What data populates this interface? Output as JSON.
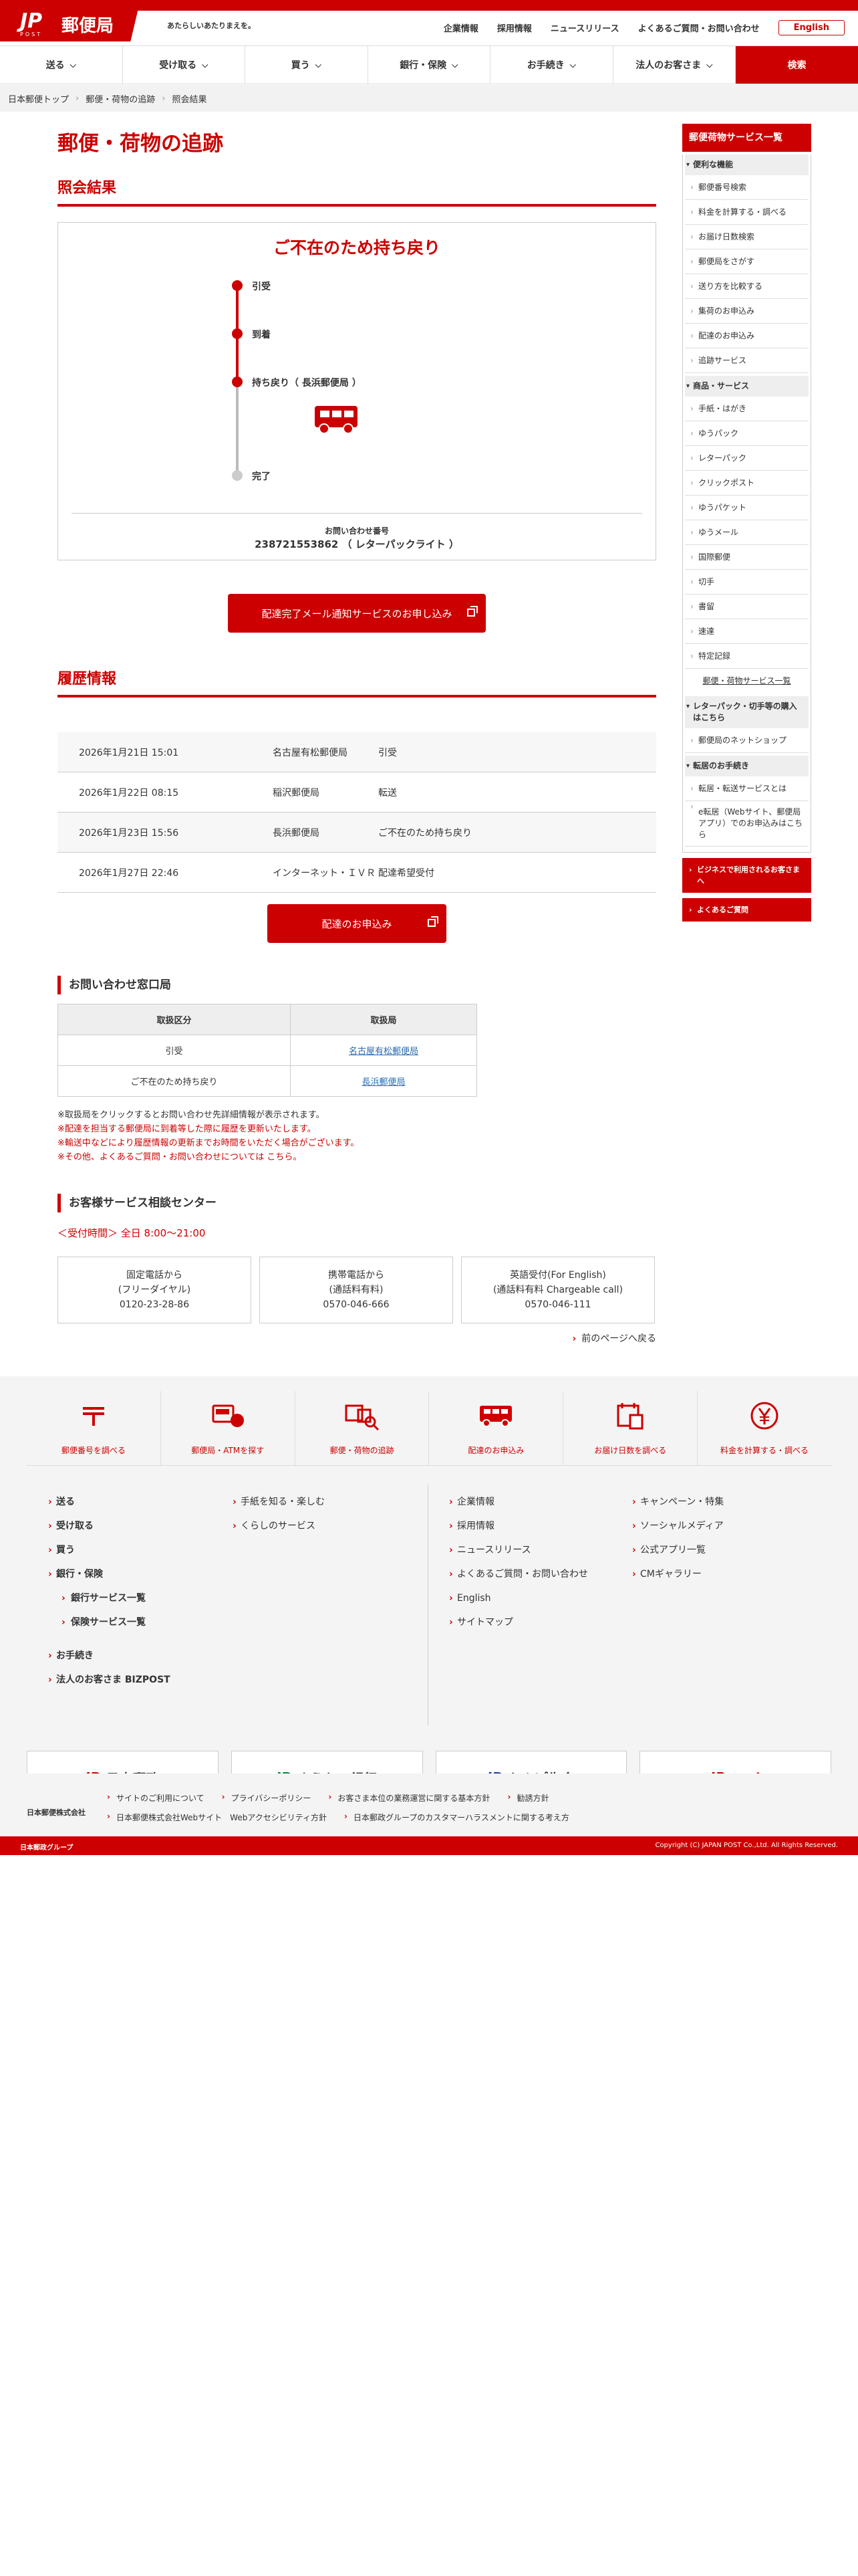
{
  "header": {
    "logo_text": "郵便局",
    "logo_mark": "JP",
    "logo_sub": "POST",
    "tagline": "あたらしいあたりまえを。",
    "links": [
      "企業情報",
      "採用情報",
      "ニュースリリース",
      "よくあるご質問・お問い合わせ"
    ],
    "english": "English"
  },
  "nav": {
    "items": [
      "送る",
      "受け取る",
      "買う",
      "銀行・保険",
      "お手続き",
      "法人のお客さま"
    ],
    "search": "検索"
  },
  "breadcrumb": [
    "日本郵便トップ",
    "郵便・荷物の追跡",
    "照会結果"
  ],
  "main": {
    "title": "郵便・荷物の追跡",
    "result_heading": "照会結果",
    "status": "ご不在のため持ち戻り",
    "timeline": [
      "引受",
      "到着",
      "持ち戻り（ 長浜郵便局 ）",
      "完了"
    ],
    "inquiry_label": "お問い合わせ番号",
    "inquiry_value": "238721553862 （ レターパックライト ）",
    "notify_button": "配達完了メール通知サービスのお申し込み",
    "history_heading": "履歴情報",
    "history": [
      {
        "datetime": "2026年1月21日 15:01",
        "office": "名古屋有松郵便局",
        "status": "引受"
      },
      {
        "datetime": "2026年1月22日 08:15",
        "office": "稲沢郵便局",
        "status": "転送"
      },
      {
        "datetime": "2026年1月23日 15:56",
        "office": "長浜郵便局",
        "status": "ご不在のため持ち戻り"
      },
      {
        "datetime": "2026年1月27日 22:46",
        "office": "インターネット・ＩＶＲ",
        "status": "配達希望受付"
      }
    ],
    "redelivery_button": "配達のお申込み",
    "office_heading": "お問い合わせ窓口局",
    "office_table": {
      "headers": [
        "取扱区分",
        "取扱局"
      ],
      "rows": [
        {
          "kind": "引受",
          "office": "名古屋有松郵便局"
        },
        {
          "kind": "ご不在のため持ち戻り",
          "office": "長浜郵便局"
        }
      ]
    },
    "notes": [
      "※取扱局をクリックするとお問い合わせ先詳細情報が表示されます。",
      "※配達を担当する郵便局に到着等した際に履歴を更新いたします。",
      "※輸送中などにより履歴情報の更新までお時間をいただく場合がございます。",
      "※その他、よくあるご質問・お問い合わせについては こちら。"
    ],
    "center_heading": "お客様サービス相談センター",
    "center_hours": "＜受付時間＞ 全日 8:00～21:00",
    "contacts": [
      {
        "line1": "固定電話から",
        "line2": "(フリーダイヤル)",
        "number": "0120-23-28-86"
      },
      {
        "line1": "携帯電話から",
        "line2": "(通話料有料)",
        "number": "0570-046-666"
      },
      {
        "line1": "英語受付(For English)",
        "line2": "(通話料有料 Chargeable call)",
        "number": "0570-046-111"
      }
    ],
    "back_link": "前のページへ戻る"
  },
  "sidebar": {
    "heading": "郵便荷物サービス一覧",
    "cat1": "便利な機能",
    "cat1_items": [
      "郵便番号検索",
      "料金を計算する・調べる",
      "お届け日数検索",
      "郵便局をさがす",
      "送り方を比較する",
      "集荷のお申込み",
      "配達のお申込み",
      "追跡サービス"
    ],
    "cat2": "商品・サービス",
    "cat2_items": [
      "手紙・はがき",
      "ゆうパック",
      "レターパック",
      "クリックポスト",
      "ゆうパケット",
      "ゆうメール",
      "国際郵便",
      "切手",
      "書留",
      "速達",
      "特定記録"
    ],
    "all_link": "郵便・荷物サービス一覧",
    "cat3": "レターパック・切手等の購入はこちら",
    "cat3_items": [
      "郵便局のネットショップ"
    ],
    "cat4": "転居のお手続き",
    "cat4_items": [
      "転居・転送サービスとは",
      "e転居（Webサイト、郵便局アプリ）でのお申込みはこちら"
    ],
    "btn1": "ビジネスで利用されるお客さまへ",
    "btn2": "よくあるご質問"
  },
  "footer": {
    "icons": [
      {
        "label": "郵便番号を調べる",
        "icon": "postal-mark-icon"
      },
      {
        "label": "郵便局・ATMを探す",
        "icon": "atm-map-icon"
      },
      {
        "label": "郵便・荷物の追跡",
        "icon": "parcel-search-icon"
      },
      {
        "label": "配達のお申込み",
        "icon": "truck-icon"
      },
      {
        "label": "お届け日数を調べる",
        "icon": "calendar-icon"
      },
      {
        "label": "料金を計算する・調べる",
        "icon": "yen-icon"
      }
    ],
    "left_col1": [
      "送る",
      "受け取る",
      "買う",
      "銀行・保険"
    ],
    "left_sub": [
      "銀行サービス一覧",
      "保険サービス一覧"
    ],
    "left_col1b": [
      "お手続き",
      "法人のお客さま BIZPOST"
    ],
    "left_col2": [
      "手紙を知る・楽しむ",
      "くらしのサービス"
    ],
    "right_col1": [
      "企業情報",
      "採用情報",
      "ニュースリリース",
      "よくあるご質問・お問い合わせ",
      "English",
      "サイトマップ"
    ],
    "right_col2": [
      "キャンペーン・特集",
      "ソーシャルメディア",
      "公式アプリ一覧",
      "CMギャラリー"
    ],
    "banners": [
      "日本郵政",
      "ゆうちょ銀行",
      "かんぽ生命",
      "JP cast"
    ],
    "corp": "日本郵便株式会社",
    "policy": [
      "サイトのご利用について",
      "プライバシーポリシー",
      "お客さま本位の業務運営に関する基本方針",
      "勧誘方針",
      "日本郵便株式会社Webサイト　Webアクセシビリティ方針",
      "日本郵政グループのカスタマーハラスメントに関する考え方"
    ],
    "group": "日本郵政グループ",
    "copyright": "Copyright (C) JAPAN POST Co.,Ltd. All Rights Reserved."
  }
}
